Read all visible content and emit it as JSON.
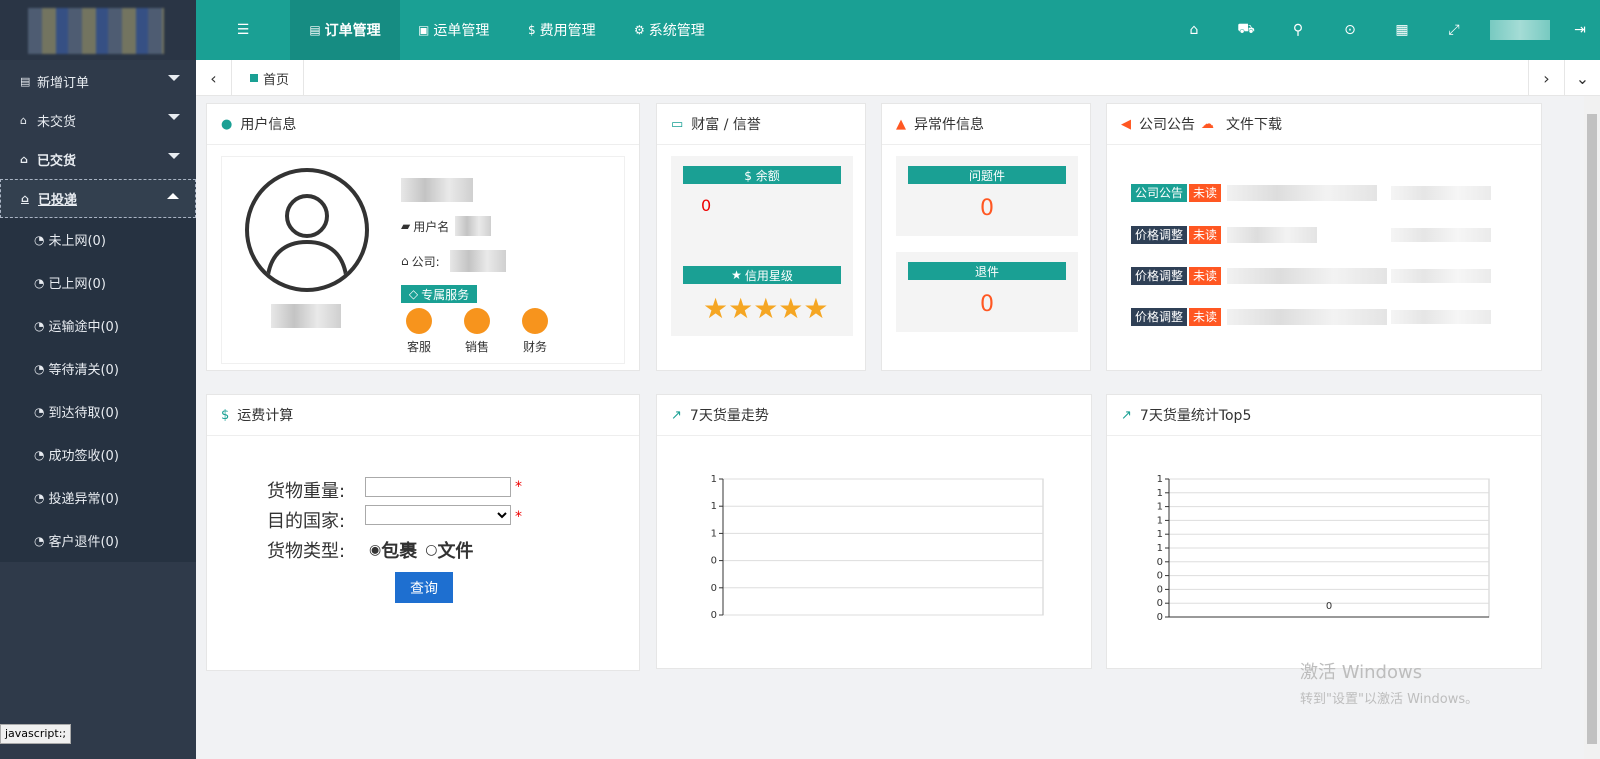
{
  "topbar": {
    "tabs": [
      {
        "label": "订单管理",
        "icon": "file-icon"
      },
      {
        "label": "运单管理",
        "icon": "id-card-icon"
      },
      {
        "label": "费用管理",
        "icon": "dollar-icon"
      },
      {
        "label": "系统管理",
        "icon": "gear-icon"
      }
    ],
    "right_icons": [
      "home-icon",
      "truck-icon",
      "search-icon",
      "map-pin-icon",
      "grid-icon",
      "fullscreen-icon",
      "logout-icon"
    ]
  },
  "sidebar": {
    "items": [
      {
        "label": "新增订单",
        "icon": "file-icon"
      },
      {
        "label": "未交货",
        "icon": "home-icon"
      },
      {
        "label": "已交货",
        "icon": "home-icon"
      },
      {
        "label": "已投递",
        "icon": "home-icon"
      }
    ],
    "subitems": [
      {
        "label": "未上网(0)"
      },
      {
        "label": "已上网(0)"
      },
      {
        "label": "运输途中(0)"
      },
      {
        "label": "等待清关(0)"
      },
      {
        "label": "到达待取(0)"
      },
      {
        "label": "成功签收(0)"
      },
      {
        "label": "投递异常(0)"
      },
      {
        "label": "客户退件(0)"
      }
    ]
  },
  "tabbar": {
    "home": "首页"
  },
  "user_panel": {
    "title": "用户信息",
    "username_label": "用户名",
    "company_label": "公司:",
    "exclusive": "专属服务",
    "services": [
      "客服",
      "销售",
      "财务"
    ]
  },
  "wealth_panel": {
    "title": "财富 / 信誉",
    "balance_label": "$ 余额",
    "balance_value": "0",
    "credit_label": "信用星级",
    "stars": "★★★★★",
    "star_color": "#f5a623"
  },
  "exception_panel": {
    "title": "异常件信息",
    "problem_label": "问题件",
    "problem_value": "0",
    "return_label": "退件",
    "return_value": "0"
  },
  "notice_panel": {
    "title": "公司公告",
    "title2": "文件下载",
    "rows": [
      {
        "tag": "公司公告",
        "status": "未读"
      },
      {
        "tag": "价格调整",
        "status": "未读"
      },
      {
        "tag": "价格调整",
        "status": "未读"
      },
      {
        "tag": "价格调整",
        "status": "未读"
      }
    ]
  },
  "freight_panel": {
    "title": "运费计算",
    "weight_label": "货物重量:",
    "country_label": "目的国家:",
    "type_label": "货物类型:",
    "type_option1": "包裹",
    "type_option2": "文件",
    "query_button": "查询"
  },
  "trend_panel": {
    "title": "7天货量走势"
  },
  "top5_panel": {
    "title": "7天货量统计Top5"
  },
  "chart_data": [
    {
      "type": "line",
      "yticks": [
        "1",
        "1",
        "1",
        "0",
        "0",
        "0"
      ],
      "values": []
    },
    {
      "type": "bar",
      "yticks": [
        "1",
        "1",
        "1",
        "1",
        "1",
        "1",
        "0",
        "0",
        "0",
        "0",
        "0"
      ],
      "values": [
        0
      ],
      "data_label": "0"
    }
  ],
  "watermark": {
    "line1": "激活 Windows",
    "line2": "转到\"设置\"以激活 Windows。"
  },
  "statusbar": "javascript:;",
  "colors": {
    "accent": "#1aa094",
    "sidebar": "#2f3a4a",
    "danger": "#ff5722",
    "primary": "#1e6fd0"
  }
}
